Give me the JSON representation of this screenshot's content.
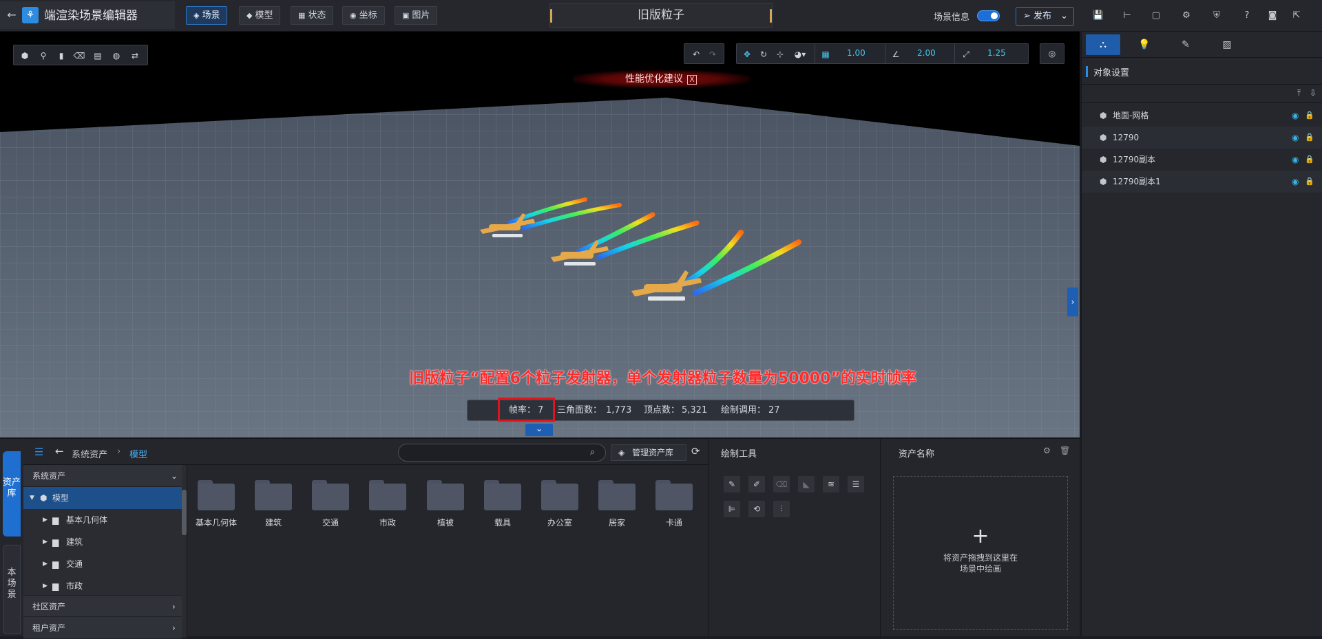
{
  "app": {
    "title": "端渲染场景编辑器",
    "back_icon": "arrow-left-icon",
    "logo_icon": "app-logo-icon"
  },
  "nav": [
    {
      "label": "场景",
      "icon": "layers-icon",
      "active": true
    },
    {
      "label": "模型",
      "icon": "cube-icon",
      "active": false
    },
    {
      "label": "状态",
      "icon": "grid-icon",
      "active": false
    },
    {
      "label": "坐标",
      "icon": "pin-icon",
      "active": false
    },
    {
      "label": "图片",
      "icon": "image-icon",
      "active": false
    }
  ],
  "scene": {
    "title": "旧版粒子",
    "info_label": "场景信息",
    "info_enabled": true,
    "publish_label": "发布"
  },
  "snap": {
    "move": "1.00",
    "rotate": "2.00",
    "scale": "1.25"
  },
  "perf_banner": {
    "text": "性能优化建议",
    "close": "X"
  },
  "annotation": "旧版粒子“配置6个粒子发射器，单个发射器粒子数量为50000”的实时帧率",
  "stats": {
    "fps_label": "帧率：",
    "fps": "7",
    "tri_label": "三角面数：",
    "tri": "1,773",
    "vert_label": "顶点数：",
    "vert": "5,321",
    "draw_label": "绘制调用：",
    "draw": "27"
  },
  "right_panel": {
    "section_title": "对象设置",
    "objects": [
      {
        "name": "地面-网格"
      },
      {
        "name": "12790"
      },
      {
        "name": "12790副本"
      },
      {
        "name": "12790副本1"
      }
    ]
  },
  "side_tabs": {
    "asset_lib": "资产库",
    "this_scene": "本场景"
  },
  "assets": {
    "breadcrumb": [
      "系统资产",
      "模型"
    ],
    "search_placeholder": "",
    "manage_label": "管理资产库",
    "tree": {
      "system": "系统资产",
      "model": "模型",
      "children": [
        "基本几何体",
        "建筑",
        "交通",
        "市政"
      ],
      "community": "社区资产",
      "tenant": "租户资产"
    },
    "folders": [
      "基本几何体",
      "建筑",
      "交通",
      "市政",
      "植被",
      "载具",
      "办公室",
      "居家",
      "卡通"
    ]
  },
  "draw_tools": {
    "title": "绘制工具"
  },
  "asset_detail": {
    "title": "资产名称",
    "drop_plus": "+",
    "drop_line1": "将资产拖拽到这里在",
    "drop_line2": "场景中绘画"
  }
}
